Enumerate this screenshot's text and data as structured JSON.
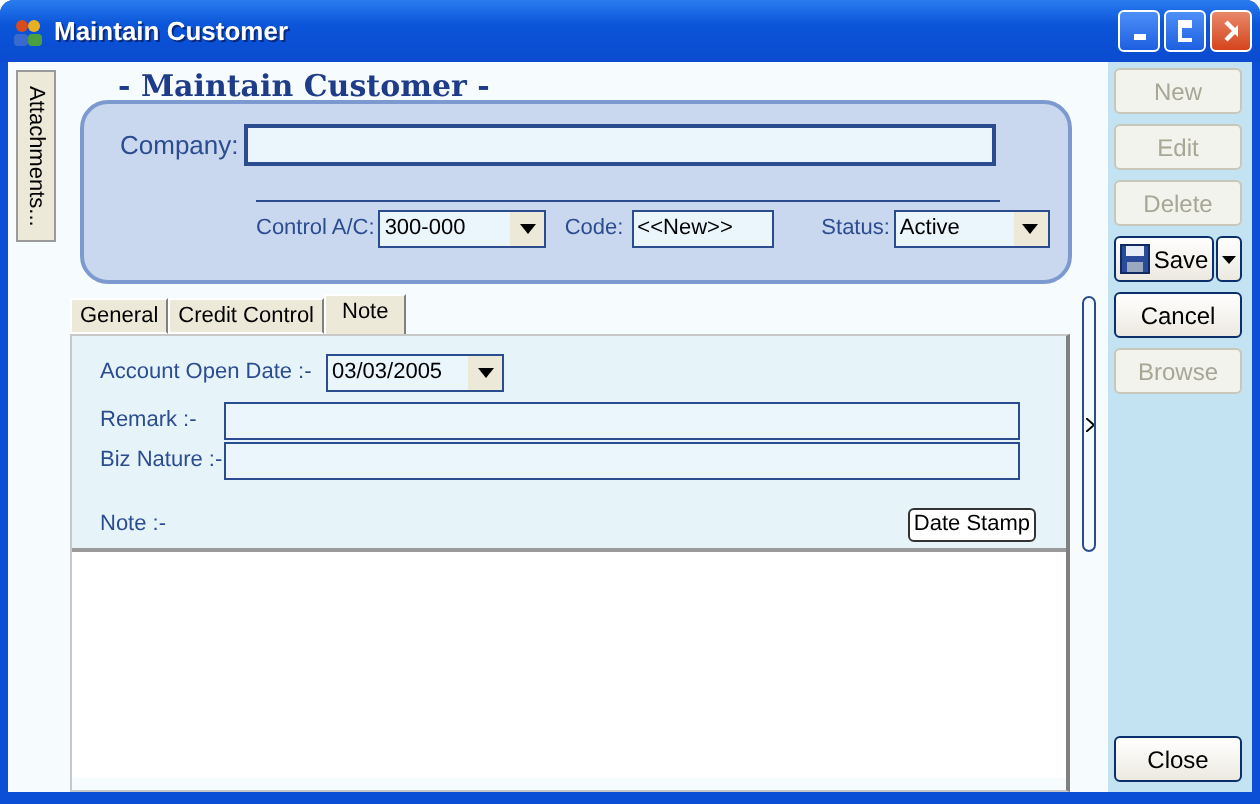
{
  "window": {
    "title": "Maintain Customer"
  },
  "side_tabs": [
    {
      "label": "Attachments..."
    }
  ],
  "header": "- Maintain Customer -",
  "company": {
    "label": "Company:"
  },
  "control_ac": {
    "label": "Control A/C:",
    "value": "300-000"
  },
  "code": {
    "label": "Code:",
    "value": "<<New>>"
  },
  "status": {
    "label": "Status:",
    "value": "Active"
  },
  "tabs": [
    {
      "label": "General",
      "selected": false
    },
    {
      "label": "Credit Control",
      "selected": false
    },
    {
      "label": "Note",
      "selected": true
    }
  ],
  "note_tab": {
    "account_open_date": {
      "label": "Account Open Date :-",
      "value": "03/03/2005"
    },
    "remark": {
      "label": "Remark :-"
    },
    "biz_nature": {
      "label": "Biz Nature :-"
    },
    "note": {
      "label": "Note :-"
    },
    "date_stamp_button": "Date Stamp"
  },
  "actions": [
    {
      "label": "New",
      "disabled": true,
      "kind": "plain"
    },
    {
      "label": "Edit",
      "disabled": true,
      "kind": "plain"
    },
    {
      "label": "Delete",
      "disabled": true,
      "kind": "plain"
    },
    {
      "label": "Save",
      "disabled": false,
      "kind": "split"
    },
    {
      "label": "Cancel",
      "disabled": false,
      "kind": "plain"
    },
    {
      "label": "Browse",
      "disabled": true,
      "kind": "plain"
    }
  ],
  "close_button": "Close"
}
